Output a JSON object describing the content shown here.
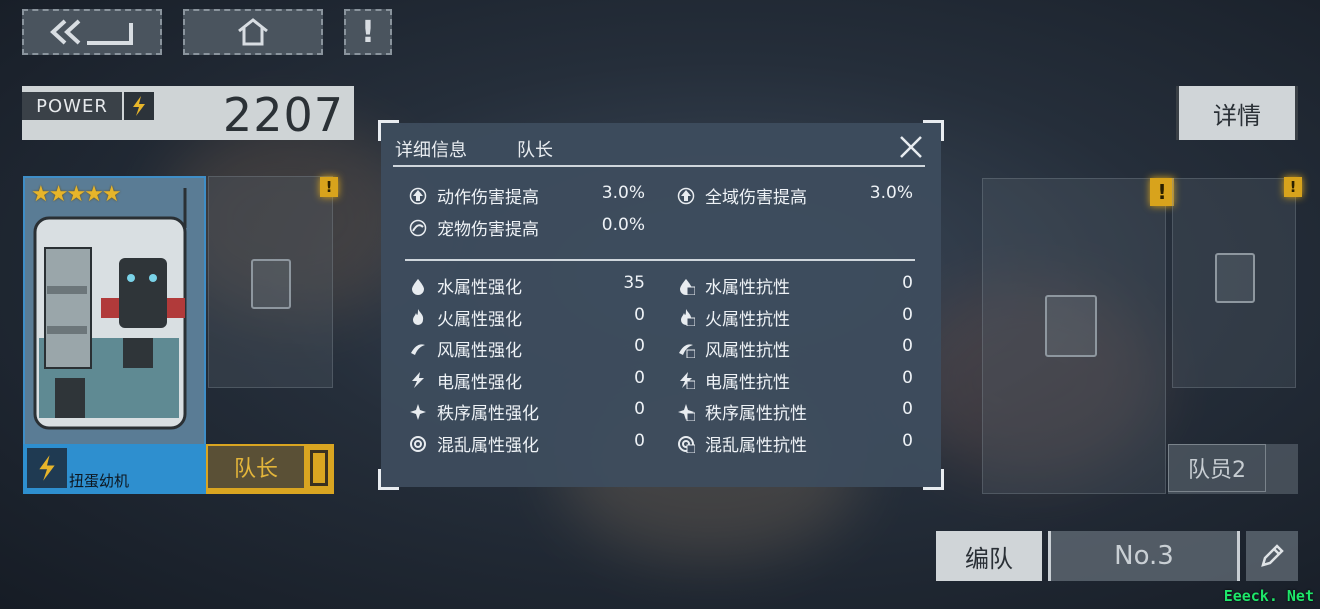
{
  "power": {
    "label": "POWER",
    "value": "2207"
  },
  "detail_button": "详情",
  "leader": {
    "name": "扭蛋幼机",
    "stars": 5,
    "role_label": "队长"
  },
  "member2_label": "队员2",
  "formation": {
    "tab_label": "编队",
    "team_number": "No.3"
  },
  "modal": {
    "tabs": [
      "详细信息",
      "队长"
    ],
    "bonuses": [
      {
        "icon": "arrow-up-icon",
        "label": "动作伤害提高",
        "value": "3.0%"
      },
      {
        "icon": "arrow-up-icon",
        "label": "全域伤害提高",
        "value": "3.0%"
      },
      {
        "icon": "pet-damage-icon",
        "label": "宠物伤害提高",
        "value": "0.0%"
      }
    ],
    "elements": [
      {
        "icon": "water-icon",
        "boost_label": "水属性强化",
        "boost_value": "35",
        "resist_label": "水属性抗性",
        "resist_value": "0"
      },
      {
        "icon": "fire-icon",
        "boost_label": "火属性强化",
        "boost_value": "0",
        "resist_label": "火属性抗性",
        "resist_value": "0"
      },
      {
        "icon": "wind-icon",
        "boost_label": "风属性强化",
        "boost_value": "0",
        "resist_label": "风属性抗性",
        "resist_value": "0"
      },
      {
        "icon": "lightning-icon",
        "boost_label": "电属性强化",
        "boost_value": "0",
        "resist_label": "电属性抗性",
        "resist_value": "0"
      },
      {
        "icon": "order-icon",
        "boost_label": "秩序属性强化",
        "boost_value": "0",
        "resist_label": "秩序属性抗性",
        "resist_value": "0"
      },
      {
        "icon": "chaos-icon",
        "boost_label": "混乱属性强化",
        "boost_value": "0",
        "resist_label": "混乱属性抗性",
        "resist_value": "0"
      }
    ]
  },
  "watermark": "Eeeck. Net",
  "colors": {
    "leader_blue": "#2e8fcf",
    "leader_gold": "#d9a521",
    "warning": "#d8a31c"
  }
}
